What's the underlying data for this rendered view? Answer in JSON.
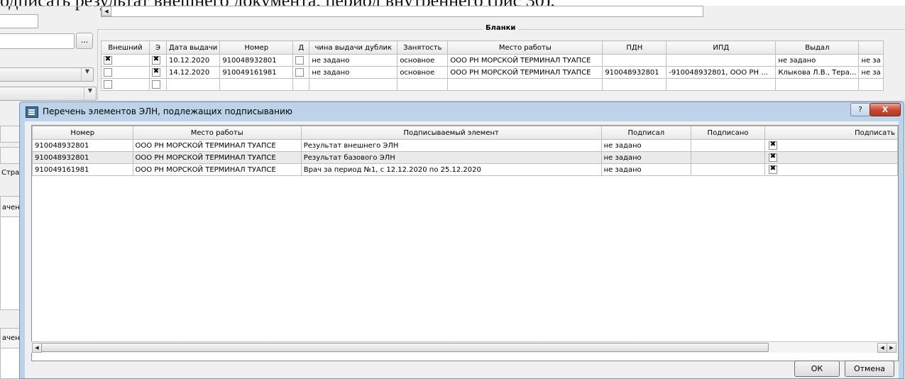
{
  "document": {
    "visible_text": "одписать результат внешнего документа, период внутреннего (рис 30)."
  },
  "background_form": {
    "ellipsis_label": "...",
    "left_fragments": [
      "Стра",
      "ачен",
      "ачен"
    ],
    "blanks_group_title": "Бланки",
    "blanks_table": {
      "columns": [
        "Внешний",
        "Э",
        "Дата выдачи",
        "Номер",
        "Д",
        "чина выдачи дублик",
        "Занятость",
        "Место работы",
        "ПДН",
        "ИПД",
        "Выдал",
        ""
      ],
      "rows": [
        {
          "external": true,
          "e": true,
          "date": "10.12.2020",
          "number": "910048932801",
          "d": false,
          "reason": "не задано",
          "employment": "основное",
          "workplace": "ООО РН МОРСКОЙ ТЕРМИНАЛ ТУАПСЕ",
          "pdn": "",
          "ipd": "",
          "issued_by": "не задано",
          "extra": "не за"
        },
        {
          "external": false,
          "e": true,
          "date": "14.12.2020",
          "number": "910049161981",
          "d": false,
          "reason": "не задано",
          "employment": "основное",
          "workplace": "ООО РН МОРСКОЙ ТЕРМИНАЛ ТУАПСЕ",
          "pdn": "910048932801",
          "ipd": "-910048932801, ООО РН ...",
          "issued_by": "Клыкова Л.В., Тера...",
          "extra": "не за"
        },
        {
          "external": false,
          "e": false,
          "date": "",
          "number": "",
          "d": false,
          "reason": "",
          "employment": "",
          "workplace": "",
          "pdn": "",
          "ipd": "",
          "issued_by": "",
          "extra": ""
        }
      ]
    }
  },
  "dialog": {
    "title": "Перечень элементов ЭЛН, подлежащих подписыванию",
    "help_label": "?",
    "close_label": "X",
    "columns": [
      "Номер",
      "Место работы",
      "Подписываемый элемент",
      "Подписал",
      "Подписано",
      "Подписать"
    ],
    "rows": [
      {
        "number": "910048932801",
        "workplace": "ООО РН МОРСКОЙ ТЕРМИНАЛ ТУАПСЕ",
        "element": "Результат внешнего ЭЛН",
        "signed_by": "не задано",
        "signed": "",
        "sign": true
      },
      {
        "number": "910048932801",
        "workplace": "ООО РН МОРСКОЙ ТЕРМИНАЛ ТУАПСЕ",
        "element": "Результат базового ЭЛН",
        "signed_by": "не задано",
        "signed": "",
        "sign": true
      },
      {
        "number": "910049161981",
        "workplace": "ООО РН МОРСКОЙ ТЕРМИНАЛ ТУАПСЕ",
        "element": "Врач за период №1, с 12.12.2020 по 25.12.2020",
        "signed_by": "не задано",
        "signed": "",
        "sign": true
      }
    ],
    "ok_label": "ОК",
    "cancel_label": "Отмена"
  }
}
